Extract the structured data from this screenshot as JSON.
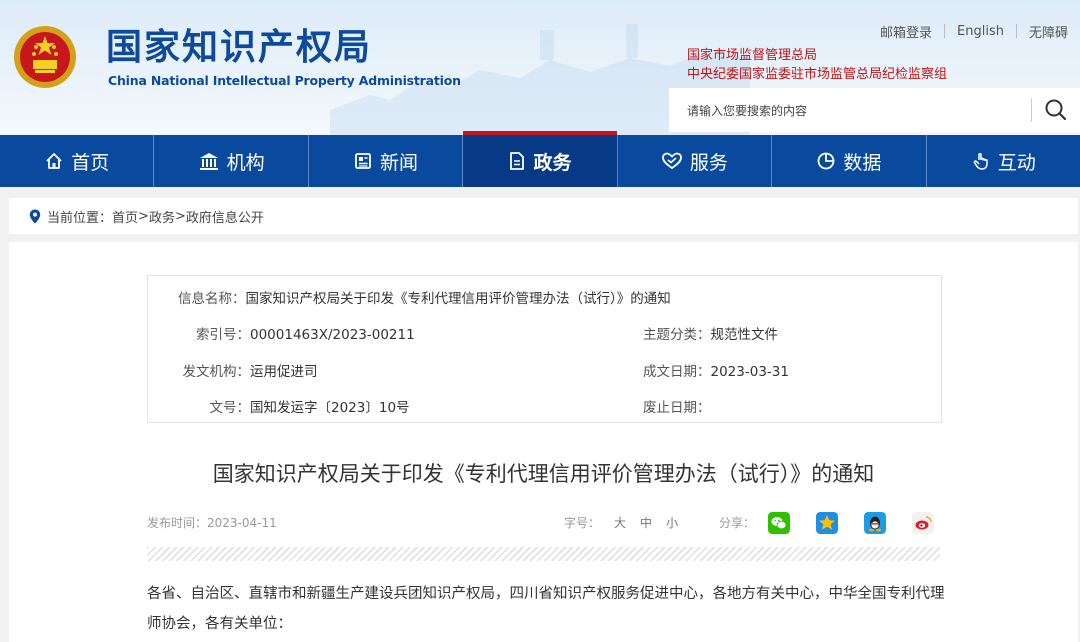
{
  "header": {
    "site_name": "国家知识产权局",
    "site_name_en": "China National Intellectual Property Administration",
    "top_links": [
      "邮箱登录",
      "English",
      "无障碍"
    ],
    "affiliations": [
      "国家市场监督管理总局",
      "中央纪委国家监委驻市场监管总局纪检监察组"
    ],
    "search_placeholder": "请输入您要搜索的内容"
  },
  "nav": {
    "items": [
      {
        "label": "首页",
        "icon": "home-icon"
      },
      {
        "label": "机构",
        "icon": "institution-icon"
      },
      {
        "label": "新闻",
        "icon": "newspaper-icon"
      },
      {
        "label": "政务",
        "icon": "document-icon",
        "active": true
      },
      {
        "label": "服务",
        "icon": "handshake-icon"
      },
      {
        "label": "数据",
        "icon": "pie-chart-icon"
      },
      {
        "label": "互动",
        "icon": "hand-pointer-icon"
      }
    ]
  },
  "breadcrumb": {
    "prefix": "当前位置：",
    "items": [
      "首页",
      "政务",
      "政府信息公开"
    ],
    "separator": ">"
  },
  "info": {
    "name_label": "信息名称：",
    "name_value": "国家知识产权局关于印发《专利代理信用评价管理办法（试行）》的通知",
    "index_label": "索引号：",
    "index_value": "00001463X/2023-00211",
    "topic_label": "主题分类：",
    "topic_value": "规范性文件",
    "issuer_label": "发文机构：",
    "issuer_value": "运用促进司",
    "date_label": "成文日期：",
    "date_value": "2023-03-31",
    "docno_label": "文号：",
    "docno_value": "国知发运字〔2023〕10号",
    "expiry_label": "废止日期：",
    "expiry_value": ""
  },
  "article": {
    "title": "国家知识产权局关于印发《专利代理信用评价管理办法（试行）》的通知",
    "publish_time": "发布时间：2023-04-11",
    "font_size_label": "字号：",
    "font_sizes": [
      "大",
      "中",
      "小"
    ],
    "share_label": "分享：",
    "share_icons": [
      "wechat-icon",
      "qzone-icon",
      "qq-icon",
      "weibo-icon"
    ],
    "body": "各省、自治区、直辖市和新疆生产建设兵团知识产权局，四川省知识产权服务促进中心，各地方有关中心，中华全国专利代理师协会，各有关单位："
  },
  "colors": {
    "nav_bg": "#0a4a9e",
    "nav_active": "#073a86",
    "accent_red": "#c8161d",
    "logo_blue": "#0d4a9c"
  }
}
